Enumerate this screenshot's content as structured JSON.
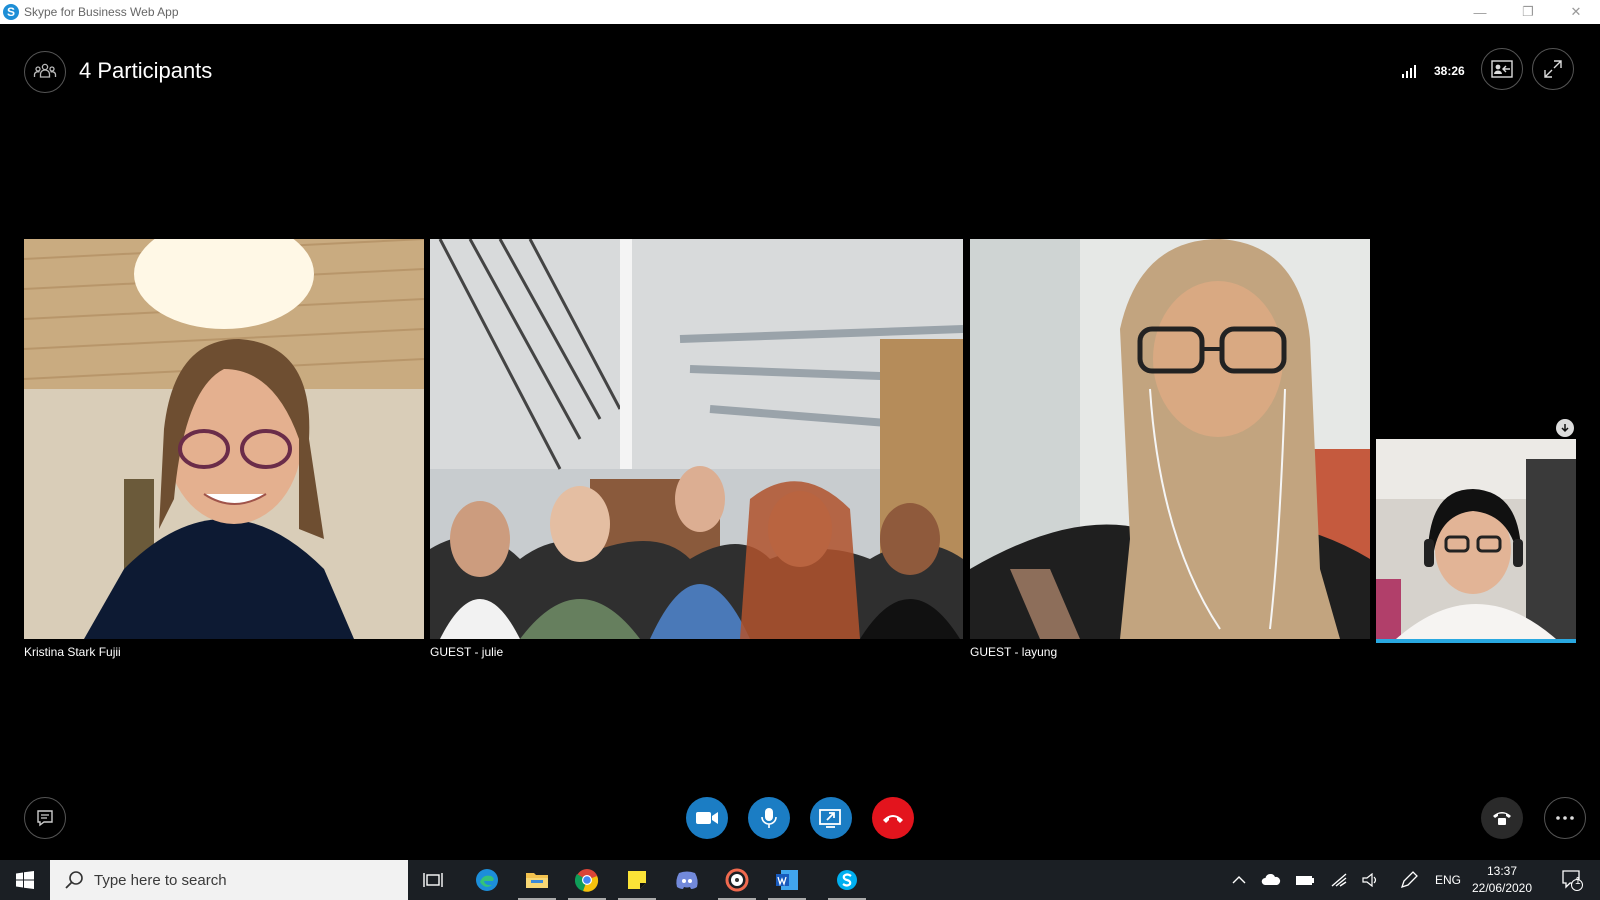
{
  "window": {
    "title": "Skype for Business Web App",
    "logo_letter": "S",
    "minimize": "—",
    "restore": "❐",
    "close": "✕"
  },
  "meeting": {
    "participants_label": "4 Participants",
    "timer": "38:26"
  },
  "videos": [
    {
      "name": "Kristina Stark Fujii"
    },
    {
      "name": "GUEST - julie"
    },
    {
      "name": "GUEST - layung"
    }
  ],
  "taskbar": {
    "search_placeholder": "Type here to search",
    "language": "ENG",
    "time": "13:37",
    "date": "22/06/2020",
    "notification_count": "1"
  },
  "colors": {
    "control_blue": "#1b7dc4",
    "hangup_red": "#e3141d",
    "self_view_border": "#29a8e0"
  }
}
